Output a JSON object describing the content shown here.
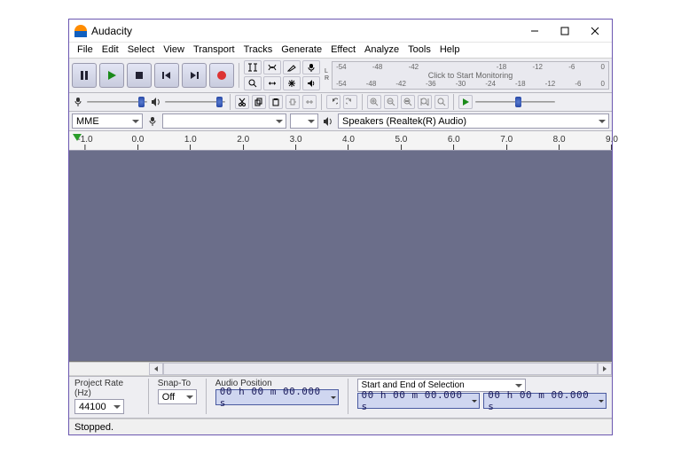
{
  "window": {
    "title": "Audacity"
  },
  "menu": [
    "File",
    "Edit",
    "Select",
    "View",
    "Transport",
    "Tracks",
    "Generate",
    "Effect",
    "Analyze",
    "Tools",
    "Help"
  ],
  "transport": {
    "pause": "pause",
    "play": "play",
    "stop": "stop",
    "skip_start": "skip-start",
    "skip_end": "skip-end",
    "record": "record"
  },
  "toolgrid1": [
    "selection-tool",
    "envelope-tool",
    "draw-tool",
    "mic-level",
    "zoom-tool",
    "timeshift-tool",
    "multi-tool",
    "speaker-level"
  ],
  "meter": {
    "ticks": [
      "-54",
      "-48",
      "-42",
      "",
      "",
      "-18",
      "-12",
      "-6",
      "0"
    ],
    "click_label": "Click to Start Monitoring",
    "ticks2": [
      "-54",
      "-48",
      "-42",
      "-36",
      "-30",
      "-24",
      "-18",
      "-12",
      "-6",
      "0"
    ]
  },
  "row2tools": [
    "cut",
    "copy",
    "paste",
    "trim",
    "silence",
    "undo",
    "redo",
    "zoom-in",
    "zoom-out",
    "zoom-sel",
    "fit-project",
    "zoom-toggle",
    "play-at-speed"
  ],
  "host": {
    "api": "MME",
    "out_device": "Speakers (Realtek(R) Audio)"
  },
  "ruler": [
    "-1.0",
    "0.0",
    "1.0",
    "2.0",
    "3.0",
    "4.0",
    "5.0",
    "6.0",
    "7.0",
    "8.0",
    "9.0"
  ],
  "bottom": {
    "rate_label": "Project Rate (Hz)",
    "rate_value": "44100",
    "snap_label": "Snap-To",
    "snap_value": "Off",
    "pos_label": "Audio Position",
    "pos_value": "00 h 00 m 00.000 s",
    "sel_label": "Start and End of Selection",
    "sel_start": "00 h 00 m 00.000 s",
    "sel_end": "00 h 00 m 00.000 s"
  },
  "status": "Stopped."
}
